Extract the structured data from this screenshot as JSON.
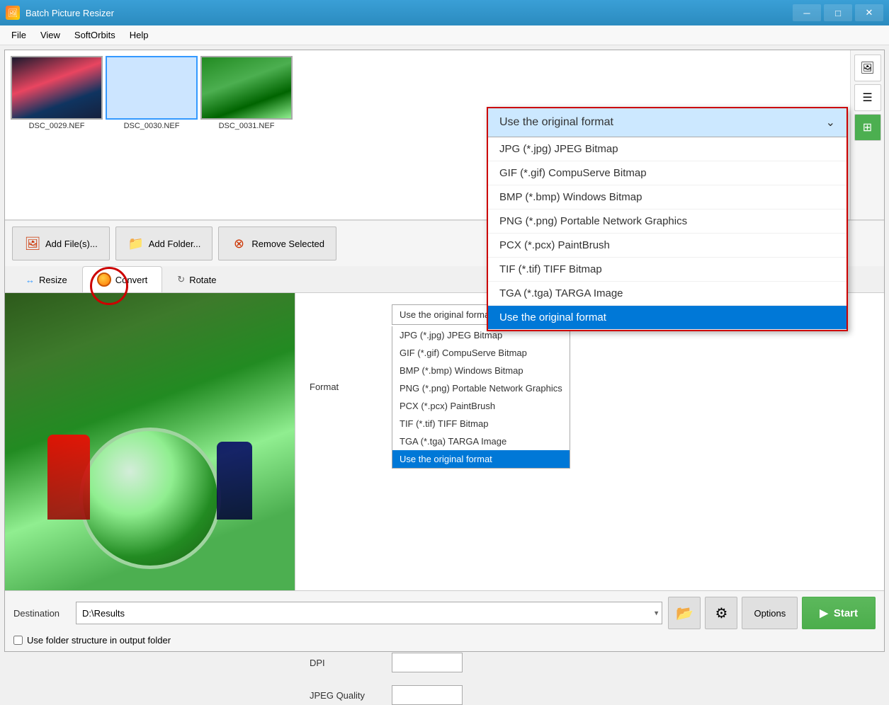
{
  "app": {
    "title": "Batch Picture Resizer",
    "icon": "🖼"
  },
  "titlebar": {
    "minimize": "─",
    "maximize": "□",
    "close": "✕"
  },
  "menu": {
    "items": [
      "File",
      "View",
      "SoftOrbits",
      "Help"
    ]
  },
  "images": [
    {
      "name": "DSC_0029.NEF",
      "selected": false
    },
    {
      "name": "DSC_0030.NEF",
      "selected": true
    },
    {
      "name": "DSC_0031.NEF",
      "selected": false
    }
  ],
  "buttons": {
    "add_files": "Add File(s)...",
    "add_folder": "Add Folder...",
    "remove_selected": "Remove Selected"
  },
  "tabs": [
    {
      "label": "Resize",
      "active": false
    },
    {
      "label": "Convert",
      "active": true
    },
    {
      "label": "Rotate",
      "active": false
    }
  ],
  "convert": {
    "format_label": "Format",
    "dpi_label": "DPI",
    "jpeg_quality_label": "JPEG Quality",
    "format_selected": "Use the original format",
    "format_options": [
      "JPG (*.jpg) JPEG Bitmap",
      "GIF (*.gif) CompuServe Bitmap",
      "BMP (*.bmp) Windows Bitmap",
      "PNG (*.png) Portable Network Graphics",
      "PCX (*.pcx) PaintBrush",
      "TIF (*.tif) TIFF Bitmap",
      "TGA (*.tga) TARGA Image",
      "Use the original format"
    ]
  },
  "big_dropdown": {
    "header": "Use the original format",
    "options": [
      "JPG (*.jpg) JPEG Bitmap",
      "GIF (*.gif) CompuServe Bitmap",
      "BMP (*.bmp) Windows Bitmap",
      "PNG (*.png) Portable Network Graphics",
      "PCX (*.pcx) PaintBrush",
      "TIF (*.tif) TIFF Bitmap",
      "TGA (*.tga) TARGA Image",
      "Use the original format"
    ],
    "selected": "Use the original format"
  },
  "destination": {
    "label": "Destination",
    "path": "D:\\Results",
    "folder_structure_label": "Use folder structure in output folder"
  },
  "bottom_buttons": {
    "options": "Options",
    "start": "Start"
  }
}
